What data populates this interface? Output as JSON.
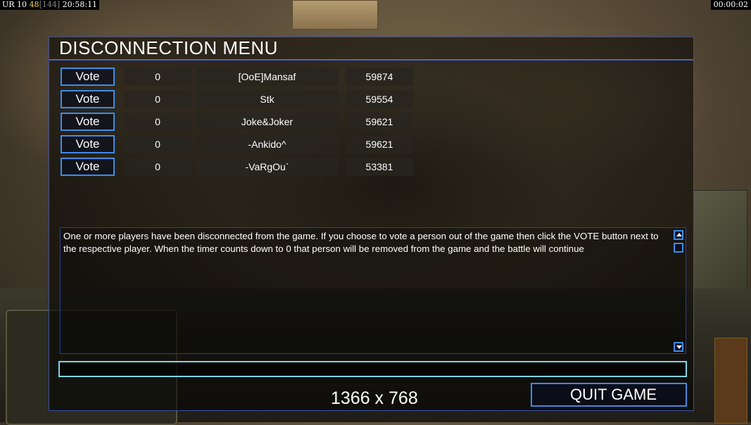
{
  "status_left": {
    "region": "UR",
    "a": "10",
    "b": "48",
    "c": "[144]",
    "clock": "20:58:11"
  },
  "status_right": {
    "timer": "00:00:02"
  },
  "dialog": {
    "title": "DISCONNECTION MENU"
  },
  "players": [
    {
      "vote_label": "Vote",
      "count": "0",
      "name": "[OoE]Mansaf",
      "ping": "59874"
    },
    {
      "vote_label": "Vote",
      "count": "0",
      "name": "Stk",
      "ping": "59554"
    },
    {
      "vote_label": "Vote",
      "count": "0",
      "name": "Joke&Joker",
      "ping": "59621"
    },
    {
      "vote_label": "Vote",
      "count": "0",
      "name": "-Ankido^",
      "ping": "59621"
    },
    {
      "vote_label": "Vote",
      "count": "0",
      "name": "-VaRgOu`",
      "ping": "53381"
    }
  ],
  "message": "One or more players have been disconnected from the game. If you choose to vote a person out of the game then click the VOTE button next to the respective player. When the timer counts down to 0 that person will be removed from the game and the battle will continue",
  "chat": {
    "value": ""
  },
  "overlay": {
    "resolution": "1366 x 768"
  },
  "buttons": {
    "quit": "QUIT GAME"
  },
  "colors": {
    "accent": "#3d8ce6",
    "title_underline": "#4b63c9",
    "input_border": "#7fd6e6"
  },
  "icons": [
    "scroll-up-icon",
    "scroll-down-icon"
  ]
}
